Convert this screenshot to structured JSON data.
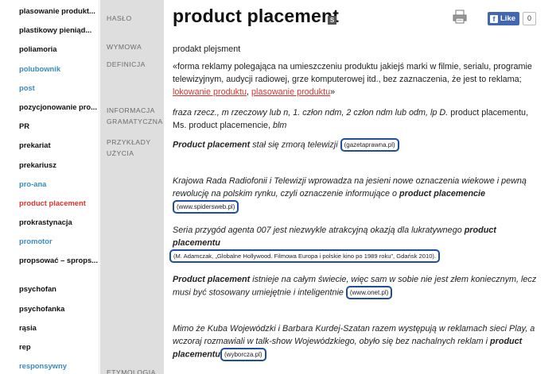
{
  "sidebar": {
    "items": [
      {
        "label": "plasowanie produkt...",
        "style": "normal"
      },
      {
        "label": "plastikowy pieniąd...",
        "style": "normal"
      },
      {
        "label": "poliamoria",
        "style": "normal"
      },
      {
        "label": "polubownik",
        "style": "blue"
      },
      {
        "label": "post",
        "style": "blue"
      },
      {
        "label": "pozycjonowanie pro...",
        "style": "normal"
      },
      {
        "label": "PR",
        "style": "normal"
      },
      {
        "label": "prekariat",
        "style": "normal"
      },
      {
        "label": "prekariusz",
        "style": "normal"
      },
      {
        "label": "pro-ana",
        "style": "blue"
      },
      {
        "label": "product placement",
        "style": "red"
      },
      {
        "label": "prokrastynacja",
        "style": "normal"
      },
      {
        "label": "promotor",
        "style": "blue"
      },
      {
        "label": "propsować – sprops...",
        "style": "normal"
      },
      {
        "label": "psychofan",
        "style": "normal"
      },
      {
        "label": "psychofanka",
        "style": "normal"
      },
      {
        "label": "rąsia",
        "style": "normal"
      },
      {
        "label": "rep",
        "style": "normal"
      },
      {
        "label": "responsywny",
        "style": "blue"
      }
    ]
  },
  "labels": {
    "haslo": "HASŁO",
    "wymowa": "WYMOWA",
    "definicja": "DEFINICJA",
    "informacja": "INFORMACJA GRAMATYCZNA",
    "przyklady": "PRZYKŁADY UŻYCIA",
    "etymologia": "ETYMOLOGIA"
  },
  "entry": {
    "title": "product placement",
    "s_badge": "S",
    "like_label": "Like",
    "like_count": "0",
    "pronunciation": "prodakt plejsment",
    "definition_text": "«forma reklamy polegająca na umieszczeniu produktu jakiejś marki w filmie, serialu, programie telewizyjnym, audycji radiowej, grze komputerowej itd., bez zaznaczenia, że jest to reklama; ",
    "definition_link1": "lokowanie produktu",
    "definition_sep": ", ",
    "definition_link2": "plasowanie produktu",
    "definition_end": "»",
    "grammar_a": "fraza rzecz., m rzeczowy lub n, 1. człon ndm, 2 człon ndm lub odm, lp D. ",
    "grammar_b": "product placementu, Ms. product placemencie, ",
    "grammar_c": "blm",
    "examples": [
      {
        "bold": "Product placement",
        "text": " stał się zmorą telewizji ",
        "source": "(gazetaprawna.pl)"
      },
      {
        "text": "Krajowa Rada Radiofonii i Telewizji wprowadza na jesieni nowe oznaczenia wiekowe i pewną rewolucję na polskim rynku, czyli oznaczenie informujące o ",
        "bold": "product placemencie",
        "source": "(www.spidersweb.pl)"
      },
      {
        "text": "Seria przygód agenta 007 jest niezwykle atrakcyjną okazją dla lukratywnego ",
        "bold": "product placementu",
        "source": "(M. Adamczak, „Globalne Hollywood. Filmowa Europa i polskie kino po 1989 roku”, Gdańsk 2010)."
      },
      {
        "bold": "Product placement",
        "text": " istnieje na całym świecie, więc sam w sobie nie jest złem koniecznym, lecz musi być stosowany umiejętnie i inteligentnie ",
        "source": "(www.onet.pl)"
      },
      {
        "text": "Mimo że Kuba Wojewódzki i Barbara Kurdej-Szatan razem występują w reklamach sieci Play, a wczoraj rozmawiali w talk-show Wojewódzkiego, obyło się bez nachalnych reklam i ",
        "bold": "product placementu",
        "source": "(wyborcza.pl)"
      }
    ]
  }
}
